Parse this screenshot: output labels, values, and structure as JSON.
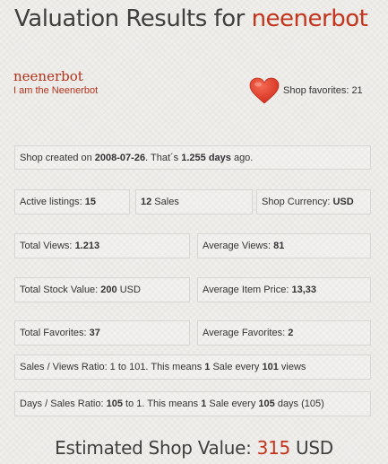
{
  "title": {
    "prefix": "Valuation Results for ",
    "shop": "neenerbot"
  },
  "shop": {
    "name": "neenerbot",
    "tagline": "I am the Neenerbot",
    "favorites_label": "Shop favorites: ",
    "favorites": "21"
  },
  "created": {
    "prefix": "Shop created on ",
    "date": "2008-07-26",
    "mid": ". That´s ",
    "days": "1.255 days",
    "suffix": " ago."
  },
  "listings": {
    "label": "Active listings: ",
    "value": "15"
  },
  "sales": {
    "value": "12",
    "label": " Sales"
  },
  "currency": {
    "label": "Shop Currency: ",
    "value": "USD"
  },
  "views": {
    "label": "Total Views: ",
    "value": "1.213"
  },
  "avg_views": {
    "label": "Average Views: ",
    "value": "81"
  },
  "stock_value": {
    "label": "Total Stock Value: ",
    "value": "200",
    "unit": " USD"
  },
  "avg_price": {
    "label": "Average Item Price: ",
    "value": "13,33"
  },
  "favorites_total": {
    "label": "Total Favorites: ",
    "value": "37"
  },
  "avg_favorites": {
    "label": "Average Favorites: ",
    "value": "2"
  },
  "sales_views": {
    "prefix": "Sales / Views Ratio: 1 to 101. This means ",
    "one": "1",
    "mid": " Sale every ",
    "num": "101",
    "suffix": " views"
  },
  "days_sales": {
    "prefix": "Days / Sales Ratio: ",
    "ratio": "105",
    "mid1": " to 1. This means ",
    "one": "1",
    "mid2": " Sale every ",
    "num": "105",
    "suffix": " days (105)"
  },
  "estimate": {
    "label": "Estimated Shop Value: ",
    "value": "315",
    "unit": " USD"
  },
  "colors": {
    "accent": "#c2341c",
    "heart": "#e23a2a"
  },
  "icons": {
    "heart": "heart-icon"
  }
}
